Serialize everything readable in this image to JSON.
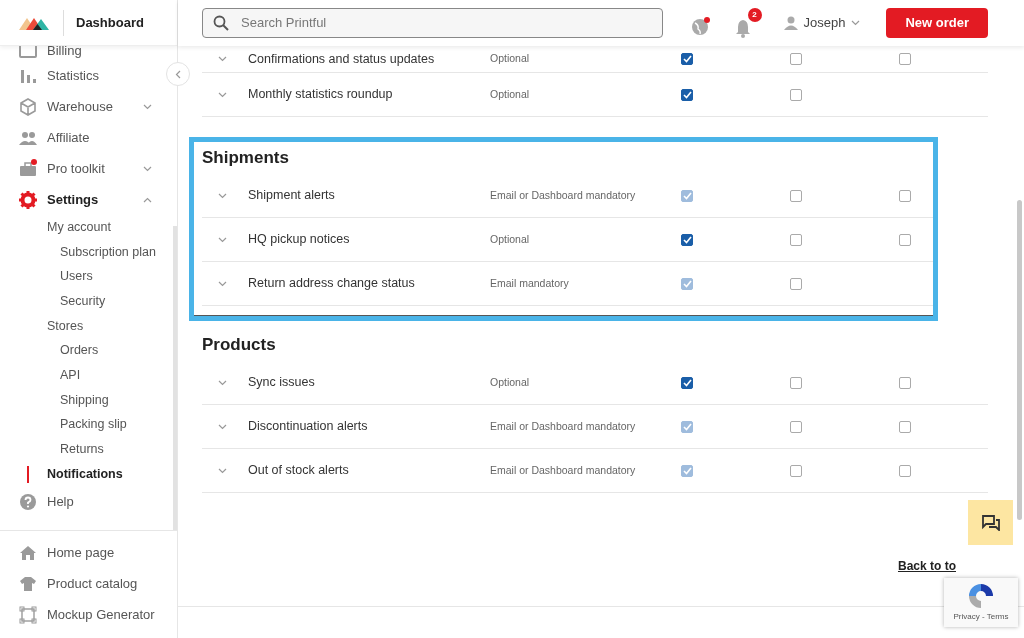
{
  "header": {
    "logo_text": "Dashboard",
    "search": {
      "placeholder": "Search Printful"
    },
    "notification_count": "2",
    "user": "Joseph",
    "new_order": "New order"
  },
  "sidebar": {
    "items": [
      {
        "label": "Billing",
        "selected": false
      },
      {
        "label": "Statistics",
        "selected": false
      },
      {
        "label": "Warehouse",
        "selected": false,
        "expanded": false
      },
      {
        "label": "Affiliate",
        "selected": false
      },
      {
        "label": "Pro toolkit",
        "selected": false,
        "expanded": false,
        "badge": true
      },
      {
        "label": "Settings",
        "selected": true,
        "expanded": true,
        "children": [
          {
            "label": "My account",
            "selected": false,
            "children": [
              {
                "label": "Subscription plan",
                "selected": false
              },
              {
                "label": "Users",
                "selected": false
              },
              {
                "label": "Security",
                "selected": false
              }
            ]
          },
          {
            "label": "Stores",
            "selected": false,
            "children": [
              {
                "label": "Orders",
                "selected": false
              },
              {
                "label": "API",
                "selected": false
              },
              {
                "label": "Shipping",
                "selected": false
              },
              {
                "label": "Packing slip",
                "selected": false
              },
              {
                "label": "Returns",
                "selected": false
              }
            ]
          },
          {
            "label": "Notifications",
            "selected": true
          }
        ]
      },
      {
        "label": "Help",
        "selected": false
      }
    ],
    "bottom_items": [
      {
        "label": "Home page"
      },
      {
        "label": "Product catalog"
      },
      {
        "label": "Mockup Generator"
      }
    ]
  },
  "sections": [
    {
      "rows": [
        {
          "label": "Confirmations and status updates",
          "requirement": "Optional",
          "checkboxes": [
            {
              "checked": true,
              "disabled": false
            },
            {
              "checked": false,
              "disabled": false
            },
            {
              "checked": false,
              "disabled": false
            }
          ]
        },
        {
          "label": "Monthly statistics roundup",
          "requirement": "Optional",
          "checkboxes": [
            {
              "checked": true,
              "disabled": false
            },
            {
              "checked": false,
              "disabled": false
            }
          ]
        }
      ]
    },
    {
      "title": "Shipments",
      "highlighted": true,
      "rows": [
        {
          "label": "Shipment alerts",
          "requirement": "Email or Dashboard mandatory",
          "checkboxes": [
            {
              "checked": true,
              "disabled": true
            },
            {
              "checked": false,
              "disabled": false
            },
            {
              "checked": false,
              "disabled": false
            }
          ]
        },
        {
          "label": "HQ pickup notices",
          "requirement": "Optional",
          "checkboxes": [
            {
              "checked": true,
              "disabled": false
            },
            {
              "checked": false,
              "disabled": false
            },
            {
              "checked": false,
              "disabled": false
            }
          ]
        },
        {
          "label": "Return address change status",
          "requirement": "Email mandatory",
          "checkboxes": [
            {
              "checked": true,
              "disabled": true
            },
            {
              "checked": false,
              "disabled": false
            }
          ]
        }
      ]
    },
    {
      "title": "Products",
      "rows": [
        {
          "label": "Sync issues",
          "requirement": "Optional",
          "checkboxes": [
            {
              "checked": true,
              "disabled": false
            },
            {
              "checked": false,
              "disabled": false
            },
            {
              "checked": false,
              "disabled": false
            }
          ]
        },
        {
          "label": "Discontinuation alerts",
          "requirement": "Email or Dashboard mandatory",
          "checkboxes": [
            {
              "checked": true,
              "disabled": true
            },
            {
              "checked": false,
              "disabled": false
            },
            {
              "checked": false,
              "disabled": false
            }
          ]
        },
        {
          "label": "Out of stock alerts",
          "requirement": "Email or Dashboard mandatory",
          "checkboxes": [
            {
              "checked": true,
              "disabled": true
            },
            {
              "checked": false,
              "disabled": false
            },
            {
              "checked": false,
              "disabled": false
            }
          ]
        }
      ]
    }
  ],
  "back_to_top": "Back to to",
  "recaptcha": {
    "links": "Privacy - Terms"
  }
}
